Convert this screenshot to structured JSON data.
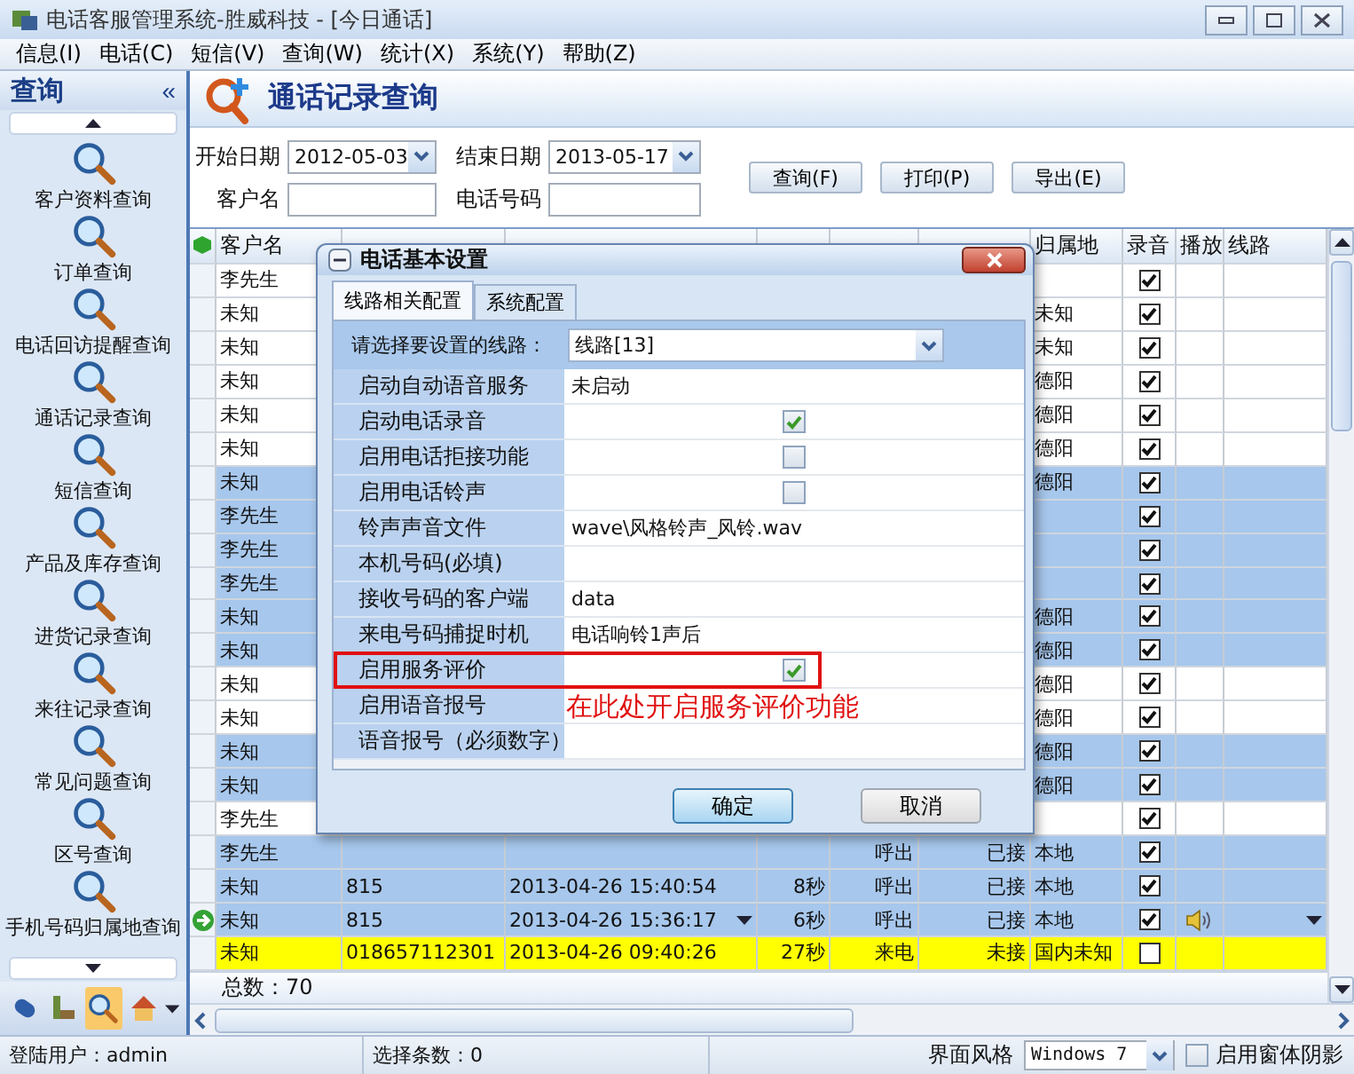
{
  "window": {
    "title": "电话客服管理系统-胜威科技 - [今日通话]"
  },
  "menu": [
    "信息(I)",
    "电话(C)",
    "短信(V)",
    "查询(W)",
    "统计(X)",
    "系统(Y)",
    "帮助(Z)"
  ],
  "sidebar": {
    "title": "查询",
    "collapse": "«",
    "items": [
      {
        "label": "客户资料查询"
      },
      {
        "label": "订单查询"
      },
      {
        "label": "电话回访提醒查询"
      },
      {
        "label": "通话记录查询"
      },
      {
        "label": "短信查询"
      },
      {
        "label": "产品及库存查询"
      },
      {
        "label": "进货记录查询"
      },
      {
        "label": "来往记录查询"
      },
      {
        "label": "常见问题查询"
      },
      {
        "label": "区号查询"
      },
      {
        "label": "手机号码归属地查询"
      }
    ],
    "tools": [
      {
        "selected": false
      },
      {
        "selected": false
      },
      {
        "selected": true
      },
      {
        "selected": false
      }
    ]
  },
  "page": {
    "title": "通话记录查询"
  },
  "filters": {
    "start_label": "开始日期",
    "start_value": "2012-05-03",
    "end_label": "结束日期",
    "end_value": "2013-05-17",
    "customer_label": "客户名",
    "phone_label": "电话号码"
  },
  "buttons": [
    "查询(F)",
    "打印(P)",
    "导出(E)"
  ],
  "grid": {
    "columns": {
      "customer": "客户名",
      "place": "归属地",
      "recorded": "录音",
      "play": "播放",
      "line": "线路"
    },
    "rows": [
      {
        "customer": "李先生",
        "kind": "plain",
        "recorded": true,
        "current": false,
        "playable": false
      },
      {
        "customer": "未知",
        "place": "未知",
        "kind": "plain",
        "recorded": true,
        "current": false,
        "playable": false
      },
      {
        "customer": "未知",
        "place": "未知",
        "kind": "plain",
        "recorded": true,
        "current": false,
        "playable": false
      },
      {
        "customer": "未知",
        "place": "德阳",
        "kind": "plain",
        "recorded": true,
        "current": false,
        "playable": false
      },
      {
        "customer": "未知",
        "place": "德阳",
        "kind": "plain",
        "recorded": true,
        "current": false,
        "playable": false
      },
      {
        "customer": "未知",
        "place": "德阳",
        "kind": "plain",
        "recorded": true,
        "current": false,
        "playable": false
      },
      {
        "customer": "未知",
        "place": "德阳",
        "kind": "marked",
        "recorded": true,
        "current": false,
        "playable": false
      },
      {
        "customer": "李先生",
        "kind": "marked",
        "recorded": true,
        "current": false,
        "playable": false
      },
      {
        "customer": "李先生",
        "kind": "marked",
        "recorded": true,
        "current": false,
        "playable": false
      },
      {
        "customer": "李先生",
        "kind": "marked",
        "recorded": true,
        "current": false,
        "playable": false
      },
      {
        "customer": "未知",
        "place": "德阳",
        "kind": "marked",
        "recorded": true,
        "current": false,
        "playable": false
      },
      {
        "customer": "未知",
        "place": "德阳",
        "kind": "marked",
        "recorded": true,
        "current": false,
        "playable": false
      },
      {
        "customer": "未知",
        "place": "德阳",
        "kind": "plain",
        "recorded": true,
        "current": false,
        "playable": false
      },
      {
        "customer": "未知",
        "place": "德阳",
        "kind": "plain",
        "recorded": true,
        "current": false,
        "playable": false
      },
      {
        "customer": "未知",
        "place": "德阳",
        "kind": "marked",
        "recorded": true,
        "current": false,
        "playable": false
      },
      {
        "customer": "未知",
        "place": "德阳",
        "kind": "marked",
        "recorded": true,
        "current": false,
        "playable": false
      },
      {
        "customer": "李先生",
        "kind": "plain",
        "recorded": true,
        "current": false,
        "playable": false
      },
      {
        "customer": "李先生",
        "type": "呼出",
        "status": "已接",
        "place": "本地",
        "kind": "marked",
        "recorded": true,
        "current": false,
        "playable": false
      },
      {
        "customer": "未知",
        "phone": "815",
        "time": "2013-04-26 15:40:54",
        "duration": "8秒",
        "type": "呼出",
        "status": "已接",
        "place": "本地",
        "kind": "marked",
        "recorded": true,
        "current": false,
        "playable": false
      },
      {
        "customer": "未知",
        "phone": "815",
        "time": "2013-04-26 15:36:17",
        "duration": "6秒",
        "type": "呼出",
        "status": "已接",
        "place": "本地",
        "kind": "marked",
        "recorded": true,
        "current": true,
        "playable": true
      },
      {
        "customer": "未知",
        "phone": "018657112301",
        "time": "2013-04-26 09:40:26",
        "duration": "27秒",
        "type": "来电",
        "status": "未接",
        "place": "国内未知",
        "kind": "missed",
        "recorded": false,
        "current": false,
        "playable": false
      }
    ],
    "total": "总数：70"
  },
  "dialog": {
    "title": "电话基本设置",
    "tabs": [
      {
        "label": "线路相关配置",
        "selected": true
      },
      {
        "label": "系统配置",
        "selected": false
      }
    ],
    "line_label": "请选择要设置的线路：",
    "line_value": "线路[13]",
    "properties": [
      {
        "label": "启动自动语音服务",
        "kind": "text",
        "value": "未启动",
        "highlighted": false
      },
      {
        "label": "启动电话录音",
        "kind": "check",
        "checked": true,
        "highlighted": false
      },
      {
        "label": "启用电话拒接功能",
        "kind": "check",
        "checked": false,
        "highlighted": false
      },
      {
        "label": "启用电话铃声",
        "kind": "check",
        "checked": false,
        "highlighted": false
      },
      {
        "label": "铃声声音文件",
        "kind": "text",
        "value": "wave\\风格铃声_风铃.wav",
        "highlighted": false
      },
      {
        "label": "本机号码(必填)",
        "kind": "empty",
        "highlighted": false
      },
      {
        "label": "接收号码的客户端",
        "kind": "text",
        "value": "data",
        "highlighted": false
      },
      {
        "label": "来电号码捕捉时机",
        "kind": "text",
        "value": "电话响铃1声后",
        "highlighted": false
      },
      {
        "label": "启用服务评价",
        "kind": "check",
        "checked": true,
        "highlighted": true
      },
      {
        "label": "启用语音报号",
        "kind": "empty",
        "highlighted": false
      },
      {
        "label": "语音报号（必须数字）",
        "kind": "empty",
        "highlighted": false
      }
    ],
    "annotation": "在此处开启服务评价功能",
    "buttons": [
      {
        "label": "确定",
        "focused": true
      },
      {
        "label": "取消",
        "focused": false
      }
    ]
  },
  "status_bar": {
    "user": "登陆用户：admin",
    "selection": "选择条数：0",
    "style_label": "界面风格",
    "style_value": "Windows 7",
    "shadow": {
      "label": "启用窗体阴影",
      "checked": false
    }
  }
}
